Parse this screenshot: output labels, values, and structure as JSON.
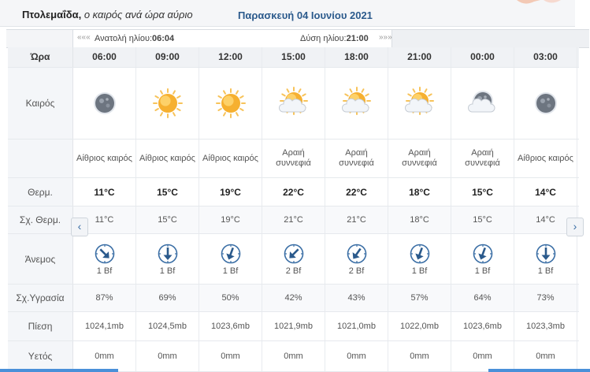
{
  "header": {
    "location": "Πτολεμαΐδα,",
    "subtitle": "ο καιρός ανά ώρα αύριο",
    "date": "Παρασκευή 04 Ιουνίου 2021"
  },
  "sunbar": {
    "sunrise_label": "Ανατολή ηλίου:",
    "sunrise_time": "06:04",
    "sunset_label": "Δύση ηλίου:",
    "sunset_time": "21:00",
    "prev_arrows": "«««",
    "next_arrows": "»»»"
  },
  "labels": {
    "hour": "Ώρα",
    "weather": "Καιρός",
    "temp": "Θερμ.",
    "feels": "Σχ. Θερμ.",
    "wind": "Άνεμος",
    "humidity": "Σχ.Υγρασία",
    "pressure": "Πίεση",
    "rain": "Υετός"
  },
  "columns": [
    {
      "hour": "06:00",
      "icon": "moon-icon",
      "desc1": "Αίθριος καιρός",
      "desc2": "",
      "temp": "11°C",
      "feels": "11°C",
      "wind_deg": 135,
      "wind": "1 Bf",
      "humidity": "87%",
      "pressure": "1024,1mb",
      "rain": "0mm"
    },
    {
      "hour": "09:00",
      "icon": "sun-icon",
      "desc1": "Αίθριος καιρός",
      "desc2": "",
      "temp": "15°C",
      "feels": "15°C",
      "wind_deg": 180,
      "wind": "1 Bf",
      "humidity": "69%",
      "pressure": "1024,5mb",
      "rain": "0mm"
    },
    {
      "hour": "12:00",
      "icon": "sun-icon",
      "desc1": "Αίθριος καιρός",
      "desc2": "",
      "temp": "19°C",
      "feels": "19°C",
      "wind_deg": 200,
      "wind": "1 Bf",
      "humidity": "50%",
      "pressure": "1023,6mb",
      "rain": "0mm"
    },
    {
      "hour": "15:00",
      "icon": "sun-cloud-icon",
      "desc1": "Αραιή",
      "desc2": "συννεφιά",
      "temp": "22°C",
      "feels": "21°C",
      "wind_deg": 225,
      "wind": "2 Bf",
      "humidity": "42%",
      "pressure": "1021,9mb",
      "rain": "0mm"
    },
    {
      "hour": "18:00",
      "icon": "sun-cloud-icon",
      "desc1": "Αραιή",
      "desc2": "συννεφιά",
      "temp": "22°C",
      "feels": "21°C",
      "wind_deg": 215,
      "wind": "2 Bf",
      "humidity": "43%",
      "pressure": "1021,0mb",
      "rain": "0mm"
    },
    {
      "hour": "21:00",
      "icon": "sun-cloud-icon",
      "desc1": "Αραιή",
      "desc2": "συννεφιά",
      "temp": "18°C",
      "feels": "18°C",
      "wind_deg": 200,
      "wind": "1 Bf",
      "humidity": "57%",
      "pressure": "1022,0mb",
      "rain": "0mm"
    },
    {
      "hour": "00:00",
      "icon": "moon-cloud-icon",
      "desc1": "Αραιή",
      "desc2": "συννεφιά",
      "temp": "15°C",
      "feels": "15°C",
      "wind_deg": 200,
      "wind": "1 Bf",
      "humidity": "64%",
      "pressure": "1023,6mb",
      "rain": "0mm"
    },
    {
      "hour": "03:00",
      "icon": "moon-icon",
      "desc1": "Αίθριος καιρός",
      "desc2": "",
      "temp": "14°C",
      "feels": "14°C",
      "wind_deg": 180,
      "wind": "1 Bf",
      "humidity": "73%",
      "pressure": "1023,3mb",
      "rain": "0mm"
    }
  ],
  "nav": {
    "prev": "‹",
    "next": "›"
  },
  "colors": {
    "accent": "#2b5a8c",
    "wind_arrow": "#3a6ea5"
  }
}
